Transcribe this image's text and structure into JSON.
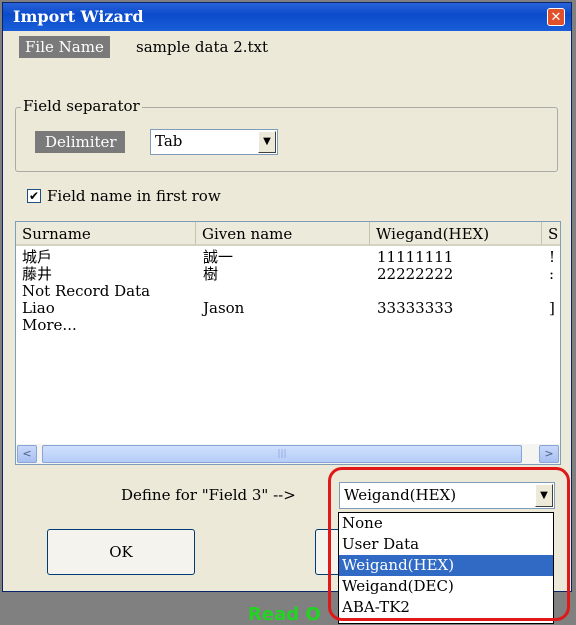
{
  "window": {
    "title": "Import Wizard",
    "close_glyph": "✕"
  },
  "file": {
    "label": "File Name",
    "value": "sample data 2.txt"
  },
  "separator": {
    "group_title": "Field separator",
    "delimiter_label": "Delimiter",
    "delimiter_value": "Tab",
    "dropdown_glyph": "▼"
  },
  "first_row": {
    "checked_glyph": "✔",
    "label": "Field name in first row"
  },
  "table": {
    "columns": [
      "Surname",
      "Given name",
      "Wiegand(HEX)",
      "S"
    ],
    "rows": [
      [
        "城戶",
        "誠一",
        "11111111",
        "!"
      ],
      [
        "藤井",
        "樹",
        "22222222",
        ":"
      ],
      [
        "Not Record Data",
        "",
        "",
        ""
      ],
      [
        "Liao",
        "Jason",
        "33333333",
        "]"
      ],
      [
        "More...",
        "",
        "",
        ""
      ]
    ],
    "scroll_left": "<",
    "scroll_right": ">",
    "thumb_grip": "|||"
  },
  "define": {
    "label": "Define for  \"Field 3\"  -->",
    "selected": "Weigand(HEX)",
    "dropdown_glyph": "▼",
    "options": [
      "None",
      "User Data",
      "Weigand(HEX)",
      "Weigand(DEC)",
      "ABA-TK2"
    ]
  },
  "buttons": {
    "ok": "OK"
  },
  "status": {
    "text": "Read O"
  },
  "colors": {
    "accent": "#316ac5",
    "annotation": "#e01818",
    "status_text": "#22d422"
  }
}
